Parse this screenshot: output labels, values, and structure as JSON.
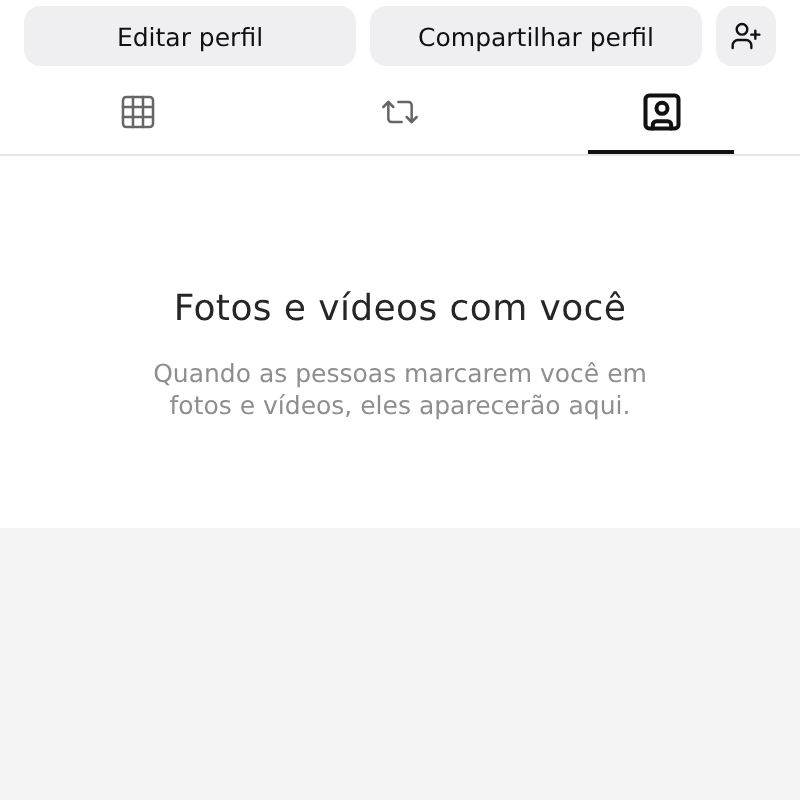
{
  "actions": {
    "buttons": [
      "Editar perfil",
      "Compartilhar perfil"
    ]
  },
  "tabs": [
    {
      "kind": "grid",
      "selected": false
    },
    {
      "kind": "reposts",
      "selected": false
    },
    {
      "kind": "tagged",
      "selected": true
    }
  ],
  "empty_state": {
    "title": "Fotos e vídeos com você",
    "message": "Quando as pessoas marcarem você em fotos e vídeos, eles aparecerão aqui."
  }
}
